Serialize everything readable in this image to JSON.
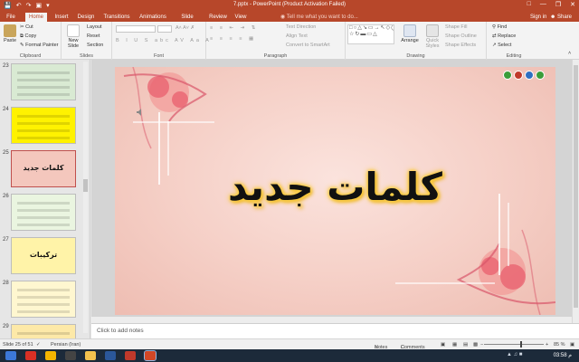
{
  "window": {
    "title": "7.pptx - PowerPoint (Product Activation Failed)",
    "qat": [
      "save-icon",
      "undo-icon",
      "redo-icon",
      "present-icon",
      "customize-icon"
    ],
    "controls": [
      "minimize-icon",
      "restore-icon",
      "close-icon"
    ]
  },
  "tabs": [
    "File",
    "Home",
    "Insert",
    "Design",
    "Transitions",
    "Animations",
    "Slide Show",
    "Review",
    "View"
  ],
  "active_tab": "Home",
  "tell_me": "Tell me what you want to do...",
  "sign_in": "Sign in",
  "share": "Share",
  "ribbon": {
    "clipboard": {
      "label": "Clipboard",
      "paste": "Paste",
      "cut": "Cut",
      "copy": "Copy",
      "format_painter": "Format Painter"
    },
    "slides": {
      "label": "Slides",
      "new_slide": "New Slide",
      "layout": "Layout",
      "reset": "Reset",
      "section": "Section"
    },
    "font": {
      "label": "Font"
    },
    "paragraph": {
      "label": "Paragraph",
      "text_direction": "Text Direction",
      "align_text": "Align Text",
      "smartart": "Convert to SmartArt"
    },
    "drawing": {
      "label": "Drawing",
      "arrange": "Arrange",
      "quick_styles": "Quick Styles",
      "shape_fill": "Shape Fill",
      "shape_outline": "Shape Outline",
      "shape_effects": "Shape Effects"
    },
    "editing": {
      "label": "Editing",
      "find": "Find",
      "replace": "Replace",
      "select": "Select"
    }
  },
  "thumbnails": [
    {
      "num": "23",
      "caption": "",
      "bg": "#d9ead3"
    },
    {
      "num": "24",
      "caption": "",
      "bg": "#fff200"
    },
    {
      "num": "25",
      "caption": "كلمات جديد",
      "bg": "#f4c7bd"
    },
    {
      "num": "26",
      "caption": "",
      "bg": "#eaf5e0"
    },
    {
      "num": "27",
      "caption": "تركيبات",
      "bg": "#fff3a8"
    },
    {
      "num": "28",
      "caption": "",
      "bg": "#fff7d0"
    },
    {
      "num": "29",
      "caption": "",
      "bg": "#fde9a8"
    }
  ],
  "selected_slide": "25",
  "slide": {
    "title": "كلمات جديد",
    "nav_buttons": [
      "back-arrow-icon",
      "home-icon",
      "help-icon",
      "forward-arrow-icon"
    ]
  },
  "notes_placeholder": "Click to add notes",
  "status": {
    "slide_info": "Slide 25 of 51",
    "language": "Persian (Iran)",
    "notes": "Notes",
    "comments": "Comments",
    "zoom": "85 %",
    "zoom_fraction": 0.6
  },
  "taskbar": {
    "apps": [
      "start-icon",
      "pdf-icon",
      "chrome-icon",
      "cmd-icon",
      "explorer-icon",
      "word-icon",
      "pdf2-icon",
      "powerpoint-icon"
    ],
    "clock": "03:58 م"
  }
}
